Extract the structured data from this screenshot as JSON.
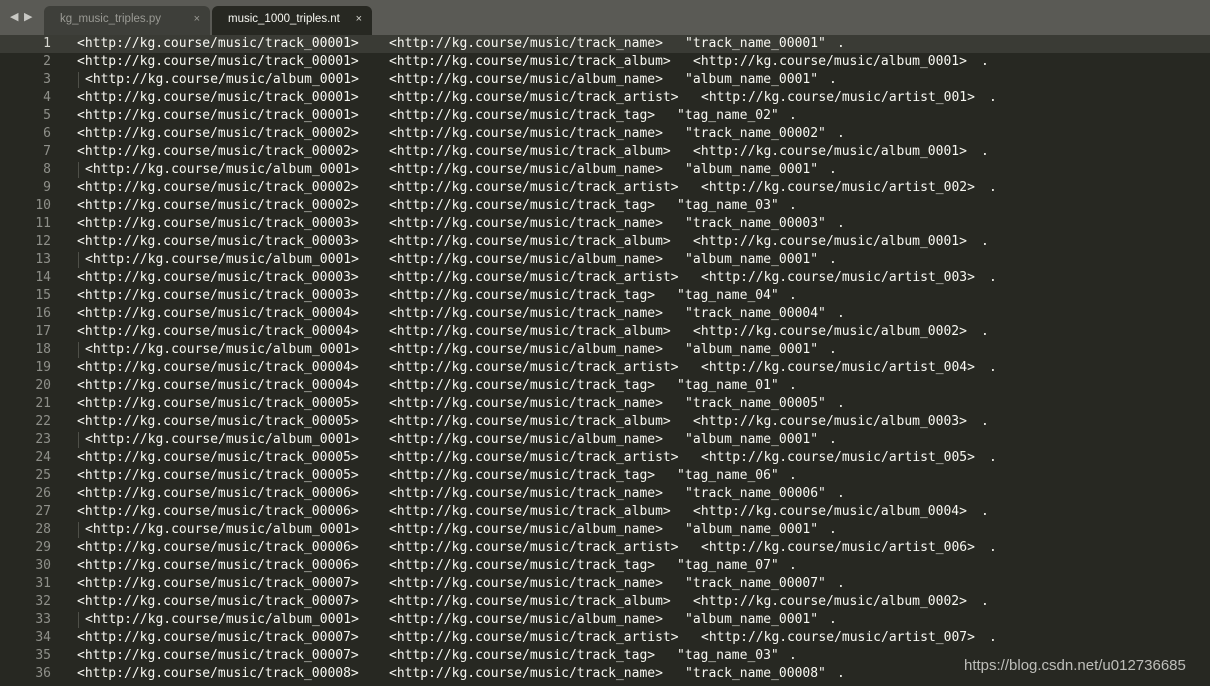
{
  "tabs": [
    {
      "label": "kg_music_triples.py",
      "active": false
    },
    {
      "label": "music_1000_triples.nt",
      "active": true
    }
  ],
  "tab_close_glyph": "×",
  "nav": {
    "back_glyph": "◀",
    "forward_glyph": "▶"
  },
  "editor": {
    "current_line": 1,
    "lines": [
      {
        "num": "1",
        "s": "<http://kg.course/music/track_00001>",
        "p": "<http://kg.course/music/track_name>",
        "o": "\"track_name_00001\"",
        "d": "."
      },
      {
        "num": "2",
        "s": "<http://kg.course/music/track_00001>",
        "p": "<http://kg.course/music/track_album>",
        "o": "<http://kg.course/music/album_0001>",
        "d": "."
      },
      {
        "num": "3",
        "s": "<http://kg.course/music/album_0001>",
        "p": "<http://kg.course/music/album_name>",
        "o": "\"album_name_0001\"",
        "d": "."
      },
      {
        "num": "4",
        "s": "<http://kg.course/music/track_00001>",
        "p": "<http://kg.course/music/track_artist>",
        "o": "<http://kg.course/music/artist_001>",
        "d": "."
      },
      {
        "num": "5",
        "s": "<http://kg.course/music/track_00001>",
        "p": "<http://kg.course/music/track_tag>",
        "o": "\"tag_name_02\"",
        "d": "."
      },
      {
        "num": "6",
        "s": "<http://kg.course/music/track_00002>",
        "p": "<http://kg.course/music/track_name>",
        "o": "\"track_name_00002\"",
        "d": "."
      },
      {
        "num": "7",
        "s": "<http://kg.course/music/track_00002>",
        "p": "<http://kg.course/music/track_album>",
        "o": "<http://kg.course/music/album_0001>",
        "d": "."
      },
      {
        "num": "8",
        "s": "<http://kg.course/music/album_0001>",
        "p": "<http://kg.course/music/album_name>",
        "o": "\"album_name_0001\"",
        "d": "."
      },
      {
        "num": "9",
        "s": "<http://kg.course/music/track_00002>",
        "p": "<http://kg.course/music/track_artist>",
        "o": "<http://kg.course/music/artist_002>",
        "d": "."
      },
      {
        "num": "10",
        "s": "<http://kg.course/music/track_00002>",
        "p": "<http://kg.course/music/track_tag>",
        "o": "\"tag_name_03\"",
        "d": "."
      },
      {
        "num": "11",
        "s": "<http://kg.course/music/track_00003>",
        "p": "<http://kg.course/music/track_name>",
        "o": "\"track_name_00003\"",
        "d": "."
      },
      {
        "num": "12",
        "s": "<http://kg.course/music/track_00003>",
        "p": "<http://kg.course/music/track_album>",
        "o": "<http://kg.course/music/album_0001>",
        "d": "."
      },
      {
        "num": "13",
        "s": "<http://kg.course/music/album_0001>",
        "p": "<http://kg.course/music/album_name>",
        "o": "\"album_name_0001\"",
        "d": "."
      },
      {
        "num": "14",
        "s": "<http://kg.course/music/track_00003>",
        "p": "<http://kg.course/music/track_artist>",
        "o": "<http://kg.course/music/artist_003>",
        "d": "."
      },
      {
        "num": "15",
        "s": "<http://kg.course/music/track_00003>",
        "p": "<http://kg.course/music/track_tag>",
        "o": "\"tag_name_04\"",
        "d": "."
      },
      {
        "num": "16",
        "s": "<http://kg.course/music/track_00004>",
        "p": "<http://kg.course/music/track_name>",
        "o": "\"track_name_00004\"",
        "d": "."
      },
      {
        "num": "17",
        "s": "<http://kg.course/music/track_00004>",
        "p": "<http://kg.course/music/track_album>",
        "o": "<http://kg.course/music/album_0002>",
        "d": "."
      },
      {
        "num": "18",
        "s": "<http://kg.course/music/album_0001>",
        "p": "<http://kg.course/music/album_name>",
        "o": "\"album_name_0001\"",
        "d": "."
      },
      {
        "num": "19",
        "s": "<http://kg.course/music/track_00004>",
        "p": "<http://kg.course/music/track_artist>",
        "o": "<http://kg.course/music/artist_004>",
        "d": "."
      },
      {
        "num": "20",
        "s": "<http://kg.course/music/track_00004>",
        "p": "<http://kg.course/music/track_tag>",
        "o": "\"tag_name_01\"",
        "d": "."
      },
      {
        "num": "21",
        "s": "<http://kg.course/music/track_00005>",
        "p": "<http://kg.course/music/track_name>",
        "o": "\"track_name_00005\"",
        "d": "."
      },
      {
        "num": "22",
        "s": "<http://kg.course/music/track_00005>",
        "p": "<http://kg.course/music/track_album>",
        "o": "<http://kg.course/music/album_0003>",
        "d": "."
      },
      {
        "num": "23",
        "s": "<http://kg.course/music/album_0001>",
        "p": "<http://kg.course/music/album_name>",
        "o": "\"album_name_0001\"",
        "d": "."
      },
      {
        "num": "24",
        "s": "<http://kg.course/music/track_00005>",
        "p": "<http://kg.course/music/track_artist>",
        "o": "<http://kg.course/music/artist_005>",
        "d": "."
      },
      {
        "num": "25",
        "s": "<http://kg.course/music/track_00005>",
        "p": "<http://kg.course/music/track_tag>",
        "o": "\"tag_name_06\"",
        "d": "."
      },
      {
        "num": "26",
        "s": "<http://kg.course/music/track_00006>",
        "p": "<http://kg.course/music/track_name>",
        "o": "\"track_name_00006\"",
        "d": "."
      },
      {
        "num": "27",
        "s": "<http://kg.course/music/track_00006>",
        "p": "<http://kg.course/music/track_album>",
        "o": "<http://kg.course/music/album_0004>",
        "d": "."
      },
      {
        "num": "28",
        "s": "<http://kg.course/music/album_0001>",
        "p": "<http://kg.course/music/album_name>",
        "o": "\"album_name_0001\"",
        "d": "."
      },
      {
        "num": "29",
        "s": "<http://kg.course/music/track_00006>",
        "p": "<http://kg.course/music/track_artist>",
        "o": "<http://kg.course/music/artist_006>",
        "d": "."
      },
      {
        "num": "30",
        "s": "<http://kg.course/music/track_00006>",
        "p": "<http://kg.course/music/track_tag>",
        "o": "\"tag_name_07\"",
        "d": "."
      },
      {
        "num": "31",
        "s": "<http://kg.course/music/track_00007>",
        "p": "<http://kg.course/music/track_name>",
        "o": "\"track_name_00007\"",
        "d": "."
      },
      {
        "num": "32",
        "s": "<http://kg.course/music/track_00007>",
        "p": "<http://kg.course/music/track_album>",
        "o": "<http://kg.course/music/album_0002>",
        "d": "."
      },
      {
        "num": "33",
        "s": "<http://kg.course/music/album_0001>",
        "p": "<http://kg.course/music/album_name>",
        "o": "\"album_name_0001\"",
        "d": "."
      },
      {
        "num": "34",
        "s": "<http://kg.course/music/track_00007>",
        "p": "<http://kg.course/music/track_artist>",
        "o": "<http://kg.course/music/artist_007>",
        "d": "."
      },
      {
        "num": "35",
        "s": "<http://kg.course/music/track_00007>",
        "p": "<http://kg.course/music/track_tag>",
        "o": "\"tag_name_03\"",
        "d": "."
      },
      {
        "num": "36",
        "s": "<http://kg.course/music/track_00008>",
        "p": "<http://kg.course/music/track_name>",
        "o": "\"track_name_00008\"",
        "d": "."
      }
    ]
  },
  "watermark": "https://blog.csdn.net/u012736685"
}
